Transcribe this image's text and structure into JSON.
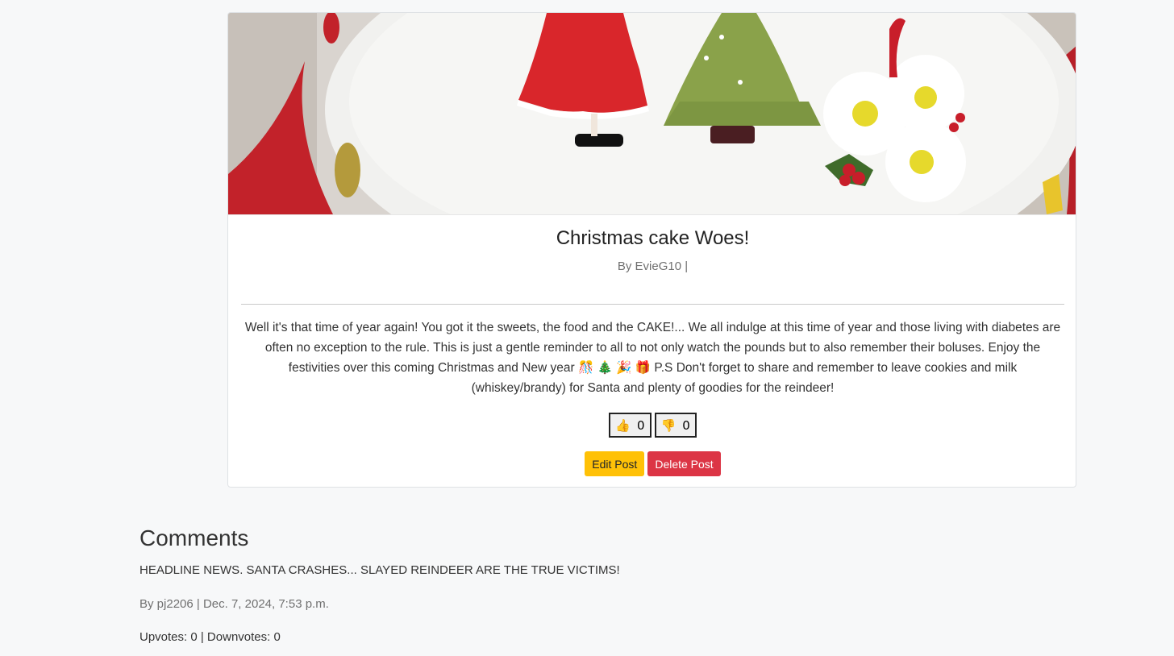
{
  "post": {
    "image_alt": "Christmas cake decorated with a Santa figure, a Christmas tree, holly and white flowers",
    "title": "Christmas cake Woes!",
    "byline": "By EvieG10 |",
    "body": "Well it's that time of year again! You got it the sweets, the food and the CAKE!... We all indulge at this time of year and those living with diabetes are often no exception to the rule. This is just a gentle reminder to all to not only watch the pounds but to also remember their boluses. Enjoy the festivities over this coming Christmas and New year 🎊 🎄 🎉 🎁 P.S Don't forget to share and remember to leave cookies and milk (whiskey/brandy) for Santa and plenty of goodies for the reindeer!",
    "upvote_icon": "👍",
    "upvote_count": "0",
    "downvote_icon": "👎",
    "downvote_count": "0",
    "edit_label": "Edit Post",
    "delete_label": "Delete Post"
  },
  "comments": {
    "heading": "Comments",
    "items": [
      {
        "text": "HEADLINE NEWS. SANTA CRASHES... SLAYED REINDEER ARE THE TRUE VICTIMS!",
        "meta": "By pj2206 | Dec. 7, 2024, 7:53 p.m.",
        "votes": "Upvotes: 0 | Downvotes: 0"
      }
    ]
  },
  "colors": {
    "edit_button": "#ffc107",
    "delete_button": "#dc3545",
    "page_background": "#f7f8f9"
  }
}
